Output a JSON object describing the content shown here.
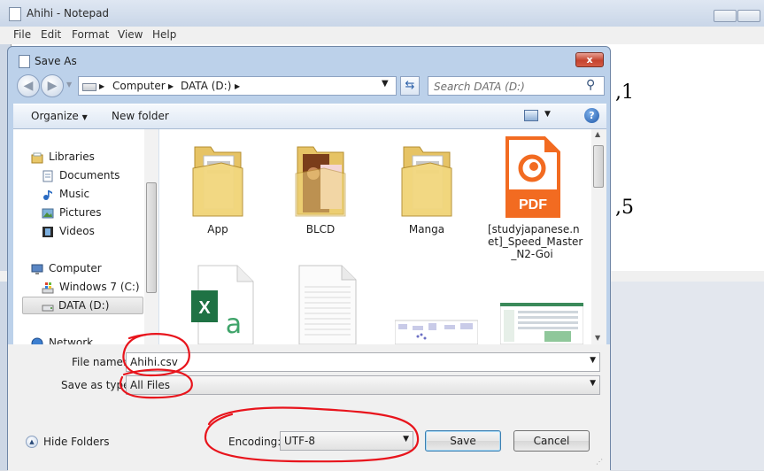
{
  "notepad": {
    "title": "Ahihi - Notepad",
    "menu": [
      "File",
      "Edit",
      "Format",
      "View",
      "Help"
    ],
    "editor_text_1": ",1",
    "editor_text_2": ",5"
  },
  "dialog": {
    "title": "Save As",
    "close_glyph": "x"
  },
  "address": {
    "segment_1": "Computer",
    "segment_2": "DATA (D:)",
    "separator": "▶"
  },
  "search": {
    "placeholder": "Search DATA (D:)"
  },
  "toolbar": {
    "organize_label": "Organize",
    "new_folder_label": "New folder",
    "help_glyph": "?"
  },
  "navpane": {
    "items": [
      {
        "label": "Libraries",
        "icon": "libraries-icon"
      },
      {
        "label": "Documents",
        "icon": "documents-icon"
      },
      {
        "label": "Music",
        "icon": "music-icon"
      },
      {
        "label": "Pictures",
        "icon": "pictures-icon"
      },
      {
        "label": "Videos",
        "icon": "videos-icon"
      },
      {
        "label": "Computer",
        "icon": "computer-icon"
      },
      {
        "label": "Windows 7 (C:)",
        "icon": "windows-drive-icon"
      },
      {
        "label": "DATA (D:)",
        "icon": "drive-icon"
      },
      {
        "label": "Network",
        "icon": "network-icon"
      }
    ]
  },
  "files": [
    {
      "name": "App",
      "type": "folder"
    },
    {
      "name": "BLCD",
      "type": "folder"
    },
    {
      "name": "Manga",
      "type": "folder"
    },
    {
      "name_line1": "[studyjapanese.n",
      "name_line2": "et]_Speed_Master",
      "name_line3": "_N2-Goi",
      "type": "pdf",
      "badge": "PDF"
    },
    {
      "name": "",
      "type": "excel",
      "badge": "X"
    },
    {
      "name": "",
      "type": "text"
    },
    {
      "name": "",
      "type": "image"
    },
    {
      "name": "",
      "type": "image"
    }
  ],
  "form": {
    "file_name_label": "File name:",
    "file_name_value": "Ahihi.csv",
    "save_as_type_label": "Save as type:",
    "save_as_type_value": "All Files",
    "encoding_label": "Encoding:",
    "encoding_value": "UTF-8",
    "save_label": "Save",
    "cancel_label": "Cancel",
    "hide_folders_label": "Hide Folders"
  },
  "colors": {
    "annotation_red": "#e8141c",
    "pdf_orange": "#f26b21",
    "excel_green": "#1f7244"
  }
}
